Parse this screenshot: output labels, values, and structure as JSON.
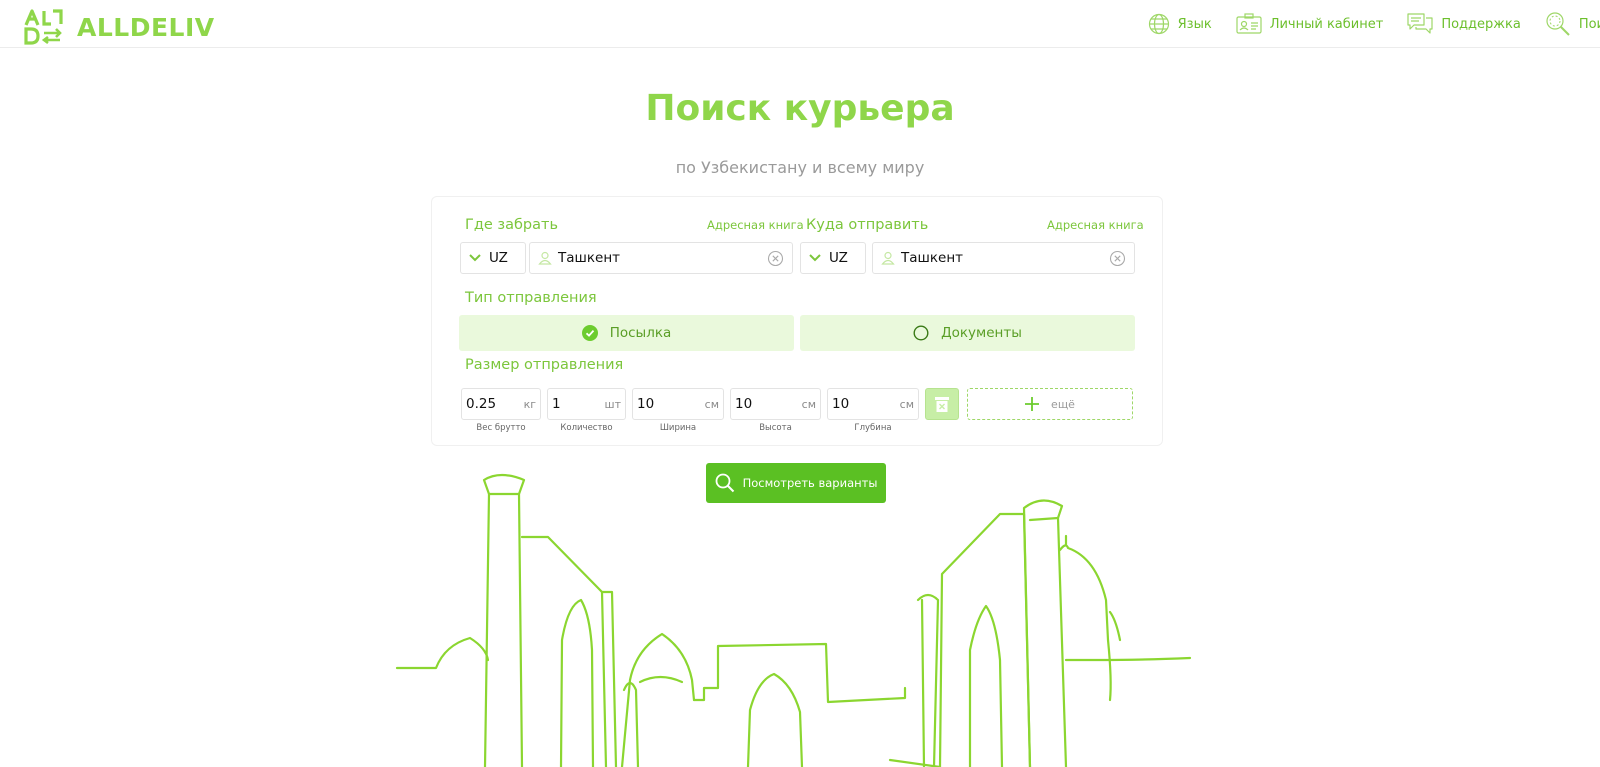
{
  "header": {
    "logo_text": "ALLDELIV",
    "nav": [
      {
        "label": "Язык",
        "icon": "globe-icon"
      },
      {
        "label": "Личный кабинет",
        "icon": "id-card-icon"
      },
      {
        "label": "Поддержка",
        "icon": "chat-icon"
      },
      {
        "label": "Поиск",
        "icon": "search-icon"
      }
    ]
  },
  "hero": {
    "title": "Поиск курьера",
    "subtitle": "по Узбекистану и всему миру"
  },
  "form": {
    "pickup": {
      "label": "Где забрать",
      "address_book": "Адресная книга",
      "country": "UZ",
      "city": "Ташкент"
    },
    "destination": {
      "label": "Куда отправить",
      "address_book": "Адресная книга",
      "country": "UZ",
      "city": "Ташкент"
    },
    "type": {
      "label": "Тип отправления",
      "options": [
        {
          "label": "Посылка",
          "selected": true
        },
        {
          "label": "Документы",
          "selected": false
        }
      ]
    },
    "size": {
      "label": "Размер отправления",
      "fields": [
        {
          "value": "0.25",
          "unit": "кг",
          "caption": "Вес брутто"
        },
        {
          "value": "1",
          "unit": "шт",
          "caption": "Количество"
        },
        {
          "value": "10",
          "unit": "см",
          "caption": "Ширина"
        },
        {
          "value": "10",
          "unit": "см",
          "caption": "Высота"
        },
        {
          "value": "10",
          "unit": "см",
          "caption": "Глубина"
        }
      ],
      "more_label": "ещё"
    },
    "submit_label": "Посмотреть варианты"
  },
  "colors": {
    "accent": "#8fd64a",
    "button": "#5bc023",
    "light_fill": "#eaf9dc",
    "skyline": "#8bd630"
  }
}
